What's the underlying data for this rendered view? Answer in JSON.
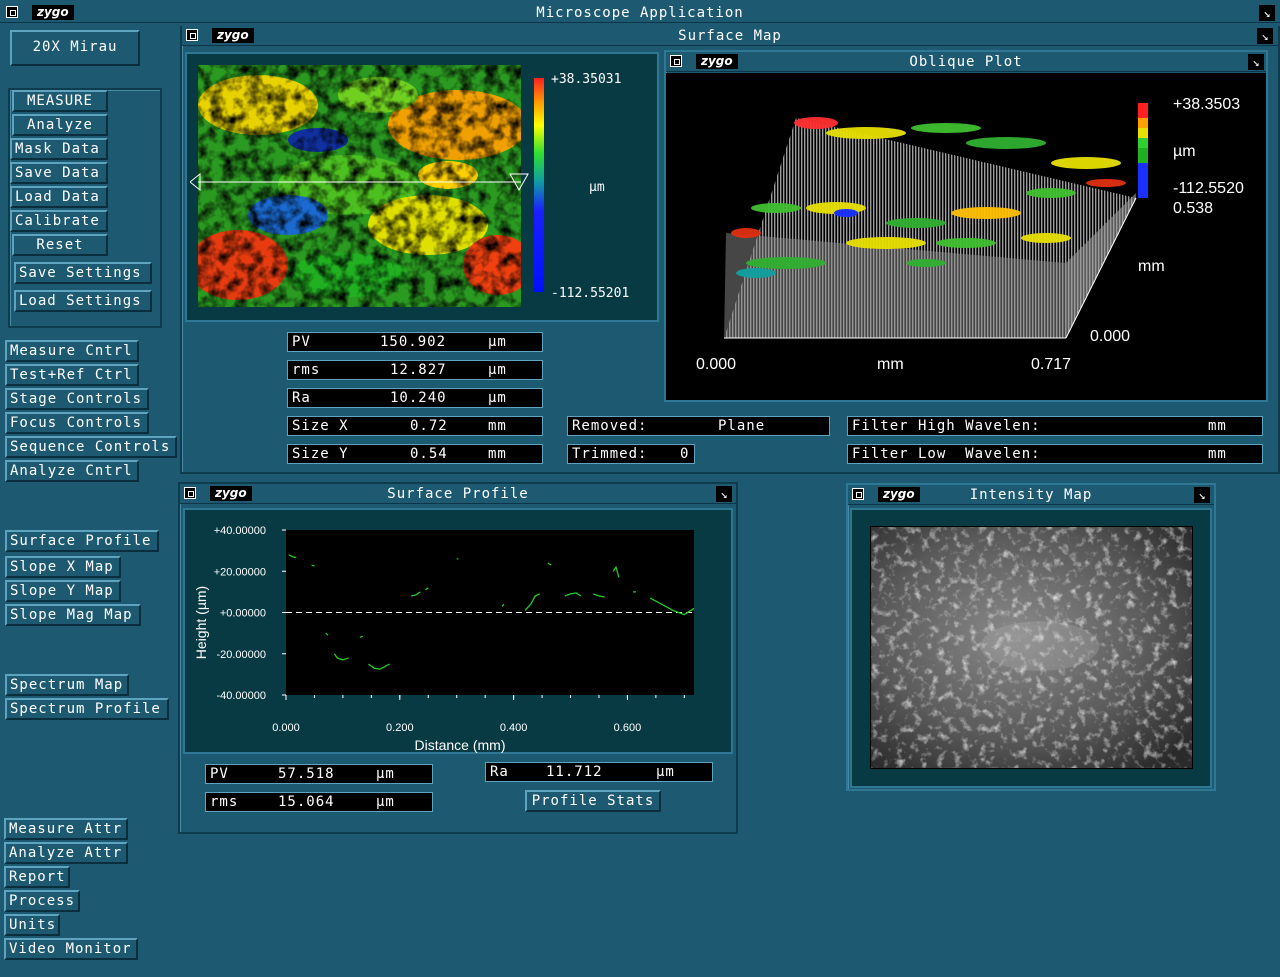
{
  "app": {
    "title": "Microscope  Application",
    "logo": "zygo"
  },
  "objective": "20X  Mirau",
  "left_menu": {
    "main": [
      "MEASURE",
      "Analyze",
      "Mask Data",
      "Save Data",
      "Load Data",
      "Calibrate",
      "Reset",
      "Save Settings",
      "Load Settings"
    ],
    "controls": [
      "Measure Cntrl",
      "Test+Ref Ctrl",
      "Stage Controls",
      "Focus Controls",
      "Sequence Controls",
      "Analyze Cntrl"
    ],
    "maps": [
      "Surface Profile",
      "Slope X Map",
      "Slope Y Map",
      "Slope Mag Map"
    ],
    "spectrum": [
      "Spectrum Map",
      "Spectrum Profile"
    ],
    "bottom": [
      "Measure Attr",
      "Analyze Attr",
      "Report",
      "Process",
      "Units",
      "Video Monitor"
    ]
  },
  "surface_map": {
    "title": "Surface Map",
    "scale_max": "+38.35031",
    "scale_min": "-112.55201",
    "scale_unit": "µm",
    "stats": [
      {
        "label": "PV",
        "value": "150.902",
        "unit": "µm"
      },
      {
        "label": "rms",
        "value": "12.827",
        "unit": "µm"
      },
      {
        "label": "Ra",
        "value": "10.240",
        "unit": "µm"
      },
      {
        "label": "Size X",
        "value": "0.72",
        "unit": "mm"
      },
      {
        "label": "Size Y",
        "value": "0.54",
        "unit": "mm"
      }
    ],
    "removed_label": "Removed:",
    "removed_value": "Plane",
    "trimmed_label": "Trimmed:",
    "trimmed_value": "0",
    "filter_high_label": "Filter High Wavelen:",
    "filter_high_unit": "mm",
    "filter_low_label": "Filter Low  Wavelen:",
    "filter_low_unit": "mm"
  },
  "oblique_plot": {
    "title": "Oblique Plot",
    "z_max": "+38.3503",
    "z_unit": "µm",
    "z_min": "-112.5520",
    "y_max": "0.538",
    "y_unit": "mm",
    "y_min": "0.000",
    "x_min": "0.000",
    "x_unit": "mm",
    "x_max": "0.717"
  },
  "surface_profile": {
    "title": "Surface Profile",
    "stats": [
      {
        "label": "PV",
        "value": "57.518",
        "unit": "µm"
      },
      {
        "label": "rms",
        "value": "15.064",
        "unit": "µm"
      },
      {
        "label": "Ra",
        "value": "11.712",
        "unit": "µm"
      }
    ],
    "stats_button": "Profile Stats"
  },
  "intensity_map": {
    "title": "Intensity Map"
  },
  "chart_data": {
    "type": "line",
    "title": "",
    "xlabel": "Distance (mm)",
    "ylabel": "Height (µm)",
    "xlim": [
      0,
      0.717
    ],
    "ylim": [
      -40,
      40
    ],
    "x_ticks": [
      "0.000",
      "0.200",
      "0.400",
      "0.600"
    ],
    "y_ticks": [
      "+40.00000",
      "+20.00000",
      "+0.00000",
      "-20.00000",
      "-40.00000"
    ],
    "grid": false,
    "series": [
      {
        "color": "#22cc22",
        "segments": [
          [
            [
              0.005,
              28
            ],
            [
              0.012,
              27
            ],
            [
              0.018,
              26.5
            ]
          ],
          [
            [
              0.045,
              23
            ],
            [
              0.05,
              22.5
            ]
          ],
          [
            [
              0.07,
              -10
            ],
            [
              0.074,
              -11
            ]
          ],
          [
            [
              0.085,
              -20
            ],
            [
              0.09,
              -22
            ],
            [
              0.1,
              -23
            ],
            [
              0.11,
              -22
            ]
          ],
          [
            [
              0.13,
              -12
            ],
            [
              0.135,
              -11.5
            ]
          ],
          [
            [
              0.145,
              -25
            ],
            [
              0.155,
              -27
            ],
            [
              0.165,
              -27.5
            ],
            [
              0.175,
              -26
            ],
            [
              0.182,
              -25
            ]
          ],
          [
            [
              0.22,
              8
            ],
            [
              0.228,
              8.5
            ],
            [
              0.236,
              10
            ]
          ],
          [
            [
              0.245,
              11
            ],
            [
              0.25,
              12
            ]
          ],
          [
            [
              0.3,
              26
            ],
            [
              0.303,
              26
            ]
          ],
          [
            [
              0.38,
              3
            ],
            [
              0.383,
              4
            ]
          ],
          [
            [
              0.42,
              1
            ],
            [
              0.43,
              4
            ],
            [
              0.438,
              8
            ],
            [
              0.446,
              9
            ]
          ],
          [
            [
              0.46,
              24
            ],
            [
              0.466,
              23
            ]
          ],
          [
            [
              0.49,
              8
            ],
            [
              0.5,
              9
            ],
            [
              0.51,
              9.5
            ],
            [
              0.518,
              8
            ]
          ],
          [
            [
              0.54,
              9
            ],
            [
              0.55,
              8
            ],
            [
              0.56,
              7.5
            ]
          ],
          [
            [
              0.575,
              20
            ],
            [
              0.58,
              22
            ],
            [
              0.585,
              17
            ]
          ],
          [
            [
              0.61,
              10
            ],
            [
              0.615,
              10
            ]
          ],
          [
            [
              0.64,
              7
            ],
            [
              0.66,
              4
            ],
            [
              0.68,
              1
            ],
            [
              0.7,
              -1
            ],
            [
              0.717,
              2
            ]
          ]
        ]
      }
    ]
  }
}
